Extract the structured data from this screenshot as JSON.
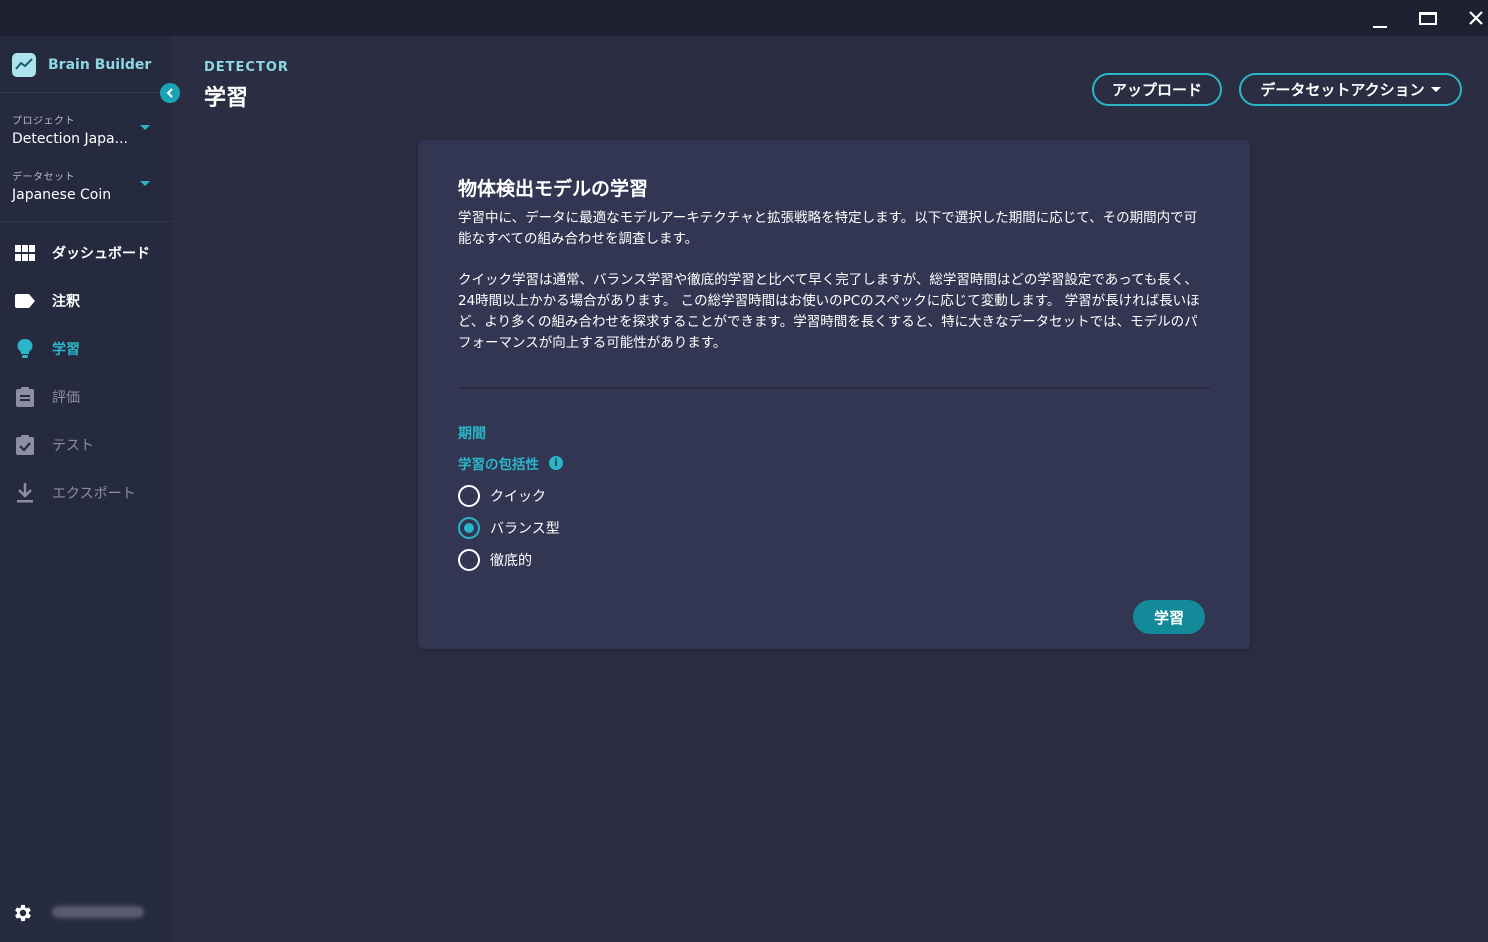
{
  "brand": {
    "name": "Brain Builder"
  },
  "sidebar": {
    "project": {
      "caption": "プロジェクト",
      "value": "Detection Japa..."
    },
    "dataset": {
      "caption": "データセット",
      "value": "Japanese Coin"
    },
    "items": [
      {
        "label": "ダッシュボード",
        "icon": "grid-icon",
        "state": "enabled"
      },
      {
        "label": "注釈",
        "icon": "tag-icon",
        "state": "enabled"
      },
      {
        "label": "学習",
        "icon": "lightbulb-icon",
        "state": "active"
      },
      {
        "label": "評価",
        "icon": "clipboard-icon",
        "state": "disabled"
      },
      {
        "label": "テスト",
        "icon": "clipboard-check-icon",
        "state": "disabled"
      },
      {
        "label": "エクスポート",
        "icon": "download-icon",
        "state": "disabled"
      }
    ]
  },
  "header": {
    "breadcrumb": "DETECTOR",
    "title": "学習",
    "upload_label": "アップロード",
    "dataset_actions_label": "データセットアクション"
  },
  "card": {
    "title": "物体検出モデルの学習",
    "para1": "学習中に、データに最適なモデルアーキテクチャと拡張戦略を特定します。以下で選択した期間に応じて、その期間内で可能なすべての組み合わせを調査します。",
    "para2": "クイック学習は通常、バランス学習や徹底的学習と比べて早く完了しますが、総学習時間はどの学習設定であっても長く、24時間以上かかる場合があります。 この総学習時間はお使いのPCのスペックに応じて変動します。 学習が長ければ長いほど、より多くの組み合わせを探求することができます。学習時間を長くすると、特に大きなデータセットでは、モデルのパフォーマンスが向上する可能性があります。",
    "section_title": "期間",
    "subtitle": "学習の包括性",
    "info_glyph": "i",
    "options": [
      {
        "label": "クイック",
        "selected": false
      },
      {
        "label": "バランス型",
        "selected": true
      },
      {
        "label": "徹底的",
        "selected": false
      }
    ],
    "train_button": "学習"
  },
  "colors": {
    "accent": "#2ab6c8",
    "background": "#2b2e43",
    "sidebar": "#262a3e",
    "card": "#323652",
    "titlebar": "#1f2133"
  }
}
